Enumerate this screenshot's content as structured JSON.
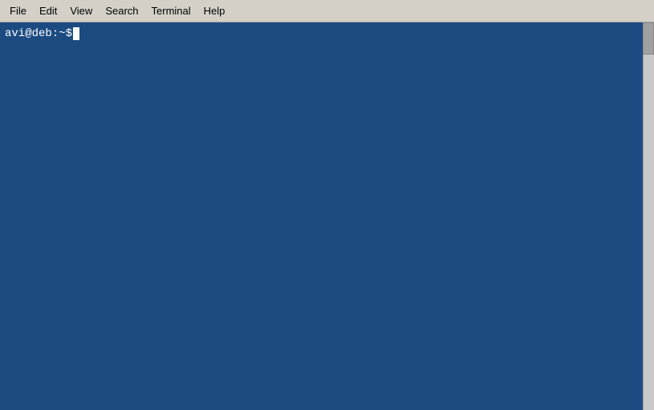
{
  "menubar": {
    "items": [
      {
        "id": "file",
        "label": "File"
      },
      {
        "id": "edit",
        "label": "Edit"
      },
      {
        "id": "view",
        "label": "View"
      },
      {
        "id": "search",
        "label": "Search"
      },
      {
        "id": "terminal",
        "label": "Terminal"
      },
      {
        "id": "help",
        "label": "Help"
      }
    ]
  },
  "terminal": {
    "prompt": "avi@deb:~$ ",
    "background_color": "#1c4b82"
  }
}
